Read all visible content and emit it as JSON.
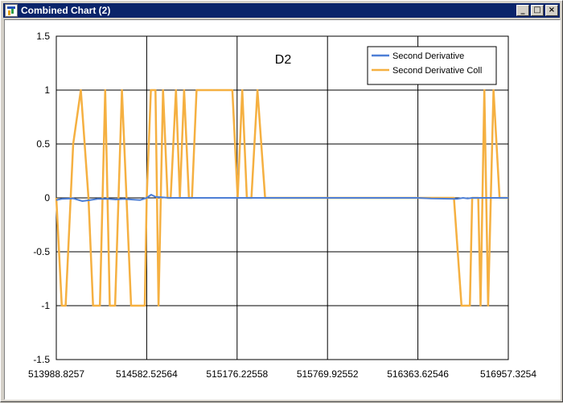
{
  "window": {
    "title": "Combined Chart (2)",
    "buttons": {
      "minimize": "_",
      "maximize": "□",
      "close": "×"
    }
  },
  "colors": {
    "series_1": "#4d7fd6",
    "series_2": "#f5b041",
    "grid": "#000000"
  },
  "chart_data": {
    "type": "line",
    "title": "D2",
    "xlim": [
      513988.8257,
      516957.3254
    ],
    "ylim": [
      -1.5,
      1.5
    ],
    "x_ticks": [
      "513988.8257",
      "514582.52564",
      "515176.22558",
      "515769.92552",
      "516363.62546",
      "516957.3254"
    ],
    "y_ticks": [
      "1.5",
      "1",
      "0.5",
      "0",
      "-0.5",
      "-1",
      "-1.5"
    ],
    "grid": true,
    "legend_position": "top-right",
    "series": [
      {
        "name": "Second Derivative",
        "x": [
          513988.8,
          514025,
          514100,
          514160,
          514210,
          514260,
          514330,
          514380,
          514430,
          514480,
          514540,
          514582.5,
          514612,
          514640,
          514680,
          514730,
          514800,
          514900,
          515050,
          515300,
          515600,
          515900,
          516200,
          516363.6,
          516450,
          516620,
          516660,
          516690,
          516720,
          516780,
          516850,
          516957.3
        ],
        "y": [
          -0.02,
          -0.01,
          -0.005,
          -0.03,
          -0.02,
          -0.01,
          -0.01,
          -0.015,
          -0.01,
          -0.015,
          -0.02,
          0.0,
          0.03,
          0.01,
          0.005,
          0.0,
          0.0,
          0.0,
          0.0,
          0.0,
          0.0,
          0.0,
          0.0,
          0.0,
          -0.005,
          -0.01,
          0.0,
          -0.005,
          0.0,
          0.0,
          0.0,
          0.0
        ]
      },
      {
        "name": "Second Derivative Coll",
        "x": [
          513988.8,
          514025,
          514050,
          514100,
          514150,
          514200,
          514230,
          514275,
          514310,
          514340,
          514375,
          514420,
          514480,
          514570,
          514582.5,
          514610,
          514640,
          514660,
          514690,
          514720,
          514740,
          514775,
          514800,
          514828,
          514860,
          514880,
          514910,
          514950,
          514985,
          515020,
          515060,
          515100,
          515145,
          515180,
          515210,
          515240,
          515270,
          515310,
          515360,
          515400,
          515450,
          515500,
          515700,
          516000,
          516300,
          516450,
          516550,
          516600,
          516650,
          516705,
          516720,
          516760,
          516775,
          516800,
          516825,
          516860,
          516900,
          516957.3
        ],
        "y": [
          0,
          -1,
          -1,
          0.5,
          1,
          0,
          -1,
          -1,
          1,
          -1,
          -1,
          1,
          -1,
          -1,
          0,
          1,
          1,
          -1,
          1,
          0,
          0,
          1,
          0,
          1,
          0,
          0,
          1,
          1,
          1,
          1,
          1,
          1,
          1,
          0,
          1,
          0,
          0,
          1,
          0,
          0,
          0,
          0,
          0,
          0,
          0,
          0,
          0,
          0,
          -1,
          -1,
          0,
          0,
          -1,
          1,
          -1,
          1,
          0,
          0
        ]
      }
    ]
  }
}
